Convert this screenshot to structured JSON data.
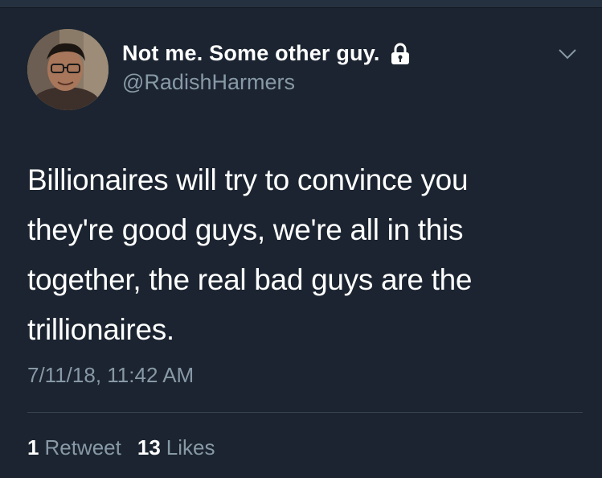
{
  "user": {
    "display_name": "Not me. Some other guy.",
    "handle": "@RadishHarmers",
    "avatar_icon": "profile-photo",
    "protected_icon": "lock-icon"
  },
  "menu": {
    "icon": "chevron-down-icon"
  },
  "tweet": {
    "text": "Billionaires will try to convince you they're good guys, we're all in this together, the real bad guys are the trillionaires.",
    "timestamp": "7/11/18, 11:42 AM"
  },
  "stats": {
    "retweets_count": "1",
    "retweets_label": "Retweet",
    "likes_count": "13",
    "likes_label": "Likes"
  },
  "colors": {
    "background": "#1b2430",
    "primary_text": "#ffffff",
    "secondary_text": "#8899a6",
    "divider": "#38444d"
  }
}
